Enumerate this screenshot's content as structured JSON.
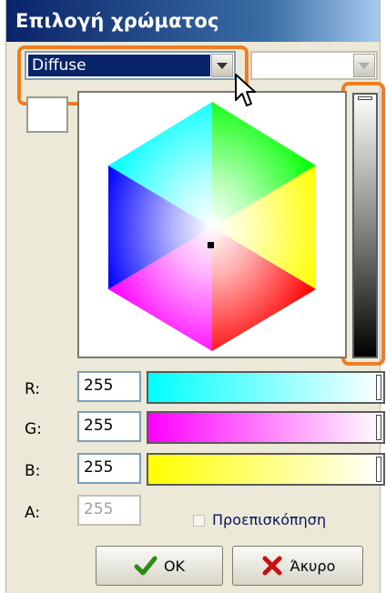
{
  "dialog": {
    "title": "Επιλογή χρώματος"
  },
  "material_select": {
    "value": "Diffuse"
  },
  "second_select": {
    "value": ""
  },
  "fields": [
    {
      "label": "R:",
      "value": "255",
      "gradient": "cyan-white"
    },
    {
      "label": "G:",
      "value": "255",
      "gradient": "magenta-white"
    },
    {
      "label": "B:",
      "value": "255",
      "gradient": "yellow-white"
    }
  ],
  "alpha": {
    "label": "A:",
    "value": "255"
  },
  "preview": {
    "label": "Προεπισκόπηση",
    "checked": false
  },
  "buttons": {
    "ok": "OK",
    "cancel": "Άκυρο"
  },
  "colors": {
    "accent_highlight": "#ef7d22",
    "title_bar": "#0a246a",
    "selection": "#0a246a"
  },
  "icons": [
    "dropdown-arrow-icon",
    "checkmark-icon",
    "cross-icon",
    "mouse-pointer-icon"
  ]
}
